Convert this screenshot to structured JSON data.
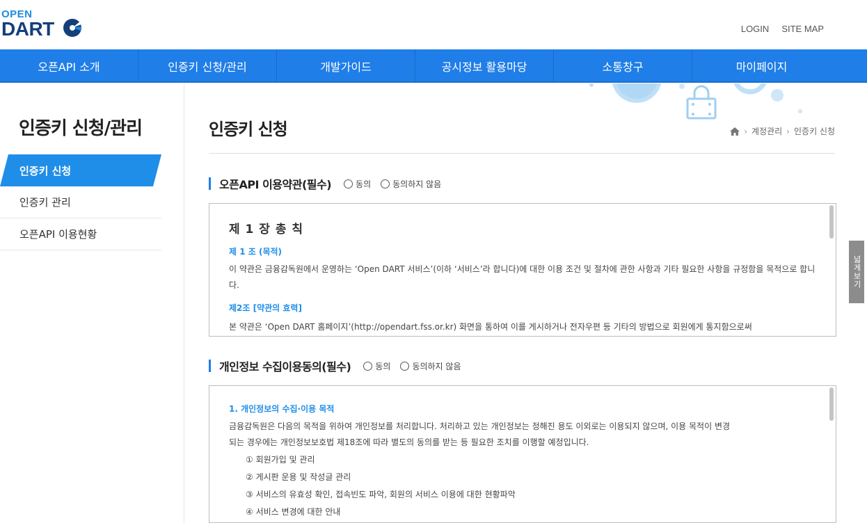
{
  "header": {
    "logo_open": "OPEN",
    "logo_dart": "DART",
    "util_links": [
      "LOGIN",
      "SITE MAP"
    ]
  },
  "nav": [
    "오픈API 소개",
    "인증키 신청/관리",
    "개발가이드",
    "공시정보 활용마당",
    "소통창구",
    "마이페이지"
  ],
  "sidebar": {
    "title": "인증키 신청/관리",
    "items": [
      {
        "label": "인증키 신청",
        "active": true
      },
      {
        "label": "인증키 관리",
        "active": false
      },
      {
        "label": "오픈API 이용현황",
        "active": false
      }
    ]
  },
  "main": {
    "title": "인증키 신청",
    "breadcrumb": [
      "계정관리",
      "인증키 신청"
    ],
    "terms": {
      "title": "오픈API 이용약관(필수)",
      "agree": "동의",
      "disagree": "동의하지 않음",
      "chapter": "제 1 장 총 칙",
      "art1_title": "제 1 조 (목적)",
      "art1_body": "이 약관은 금융감독원에서 운영하는 ‘Open DART 서비스’(이하 ‘서비스’라 합니다)에 대한 이용 조건 및 절차에 관한 사항과 기타 필요한 사항을 규정함을 목적으로 합니다.",
      "art2_title": "제2조 [약관의 효력]",
      "art2_body": "본 약관은 ‘Open DART 홈페이지’(http://opendart.fss.or.kr) 화면을 통하여 이를 게시하거나 전자우편 등 기타의 방법으로 회원에게 통지함으로써"
    },
    "privacy": {
      "title": "개인정보 수집이용동의(필수)",
      "agree": "동의",
      "disagree": "동의하지 않음",
      "sec1_title": "1. 개인정보의 수집·이용 목적",
      "sec1_body1": "금융감독원은 다음의 목적을 위하여 개인정보를 처리합니다. 처리하고 있는 개인정보는 정해진 용도 이외로는 이용되지 않으며, 이용 목적이 변경",
      "sec1_body2": "되는 경우에는 개인정보보호법 제18조에 따라 별도의 동의를 받는 등 필요한 조치를 이행할 예정입니다.",
      "items": [
        "① 회원가입 및 관리",
        "② 게시판 운용 및 작성글 관리",
        "③ 서비스의 유효성 확인, 접속빈도 파악, 회원의 서비스 이용에 대한 현황파악",
        "④ 서비스 변경에 대한 안내"
      ]
    }
  },
  "side_tab": "넓게보기",
  "colors": {
    "primary": "#1f7ee8",
    "accent": "#1f8ee8"
  }
}
